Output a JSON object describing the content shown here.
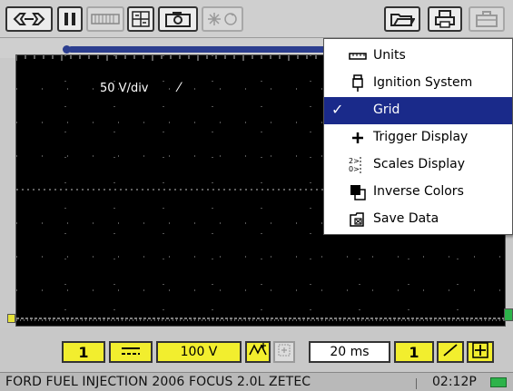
{
  "scope": {
    "volts_per_div": "50 V/div",
    "trigger_slope_symbol": "⁄"
  },
  "menu": {
    "items": [
      {
        "label": "Units",
        "icon": "ruler-icon",
        "checked": false
      },
      {
        "label": "Ignition System",
        "icon": "spark-plug-icon",
        "checked": false
      },
      {
        "label": "Grid",
        "icon": "",
        "checked": true
      },
      {
        "label": "Trigger Display",
        "icon": "plus-icon",
        "checked": false
      },
      {
        "label": "Scales Display",
        "icon": "scales-icon",
        "checked": false
      },
      {
        "label": "Inverse Colors",
        "icon": "inverse-colors-icon",
        "checked": false
      },
      {
        "label": "Save Data",
        "icon": "save-data-icon",
        "checked": false
      }
    ],
    "check_symbol": "✓"
  },
  "controls": {
    "channel": "1",
    "coupling": "⎓",
    "volts_range": "100 V",
    "timebase": "20 ms",
    "trigger_channel": "1"
  },
  "status": {
    "vehicle": "FORD FUEL INJECTION 2006 FOCUS 2.0L ZETEC",
    "time": "02:12P"
  },
  "colors": {
    "highlight": "#1a2a8a",
    "control_yellow": "#f2ee2e",
    "timebase_bar": "#2c3e8f",
    "battery_green": "#2db34a"
  }
}
